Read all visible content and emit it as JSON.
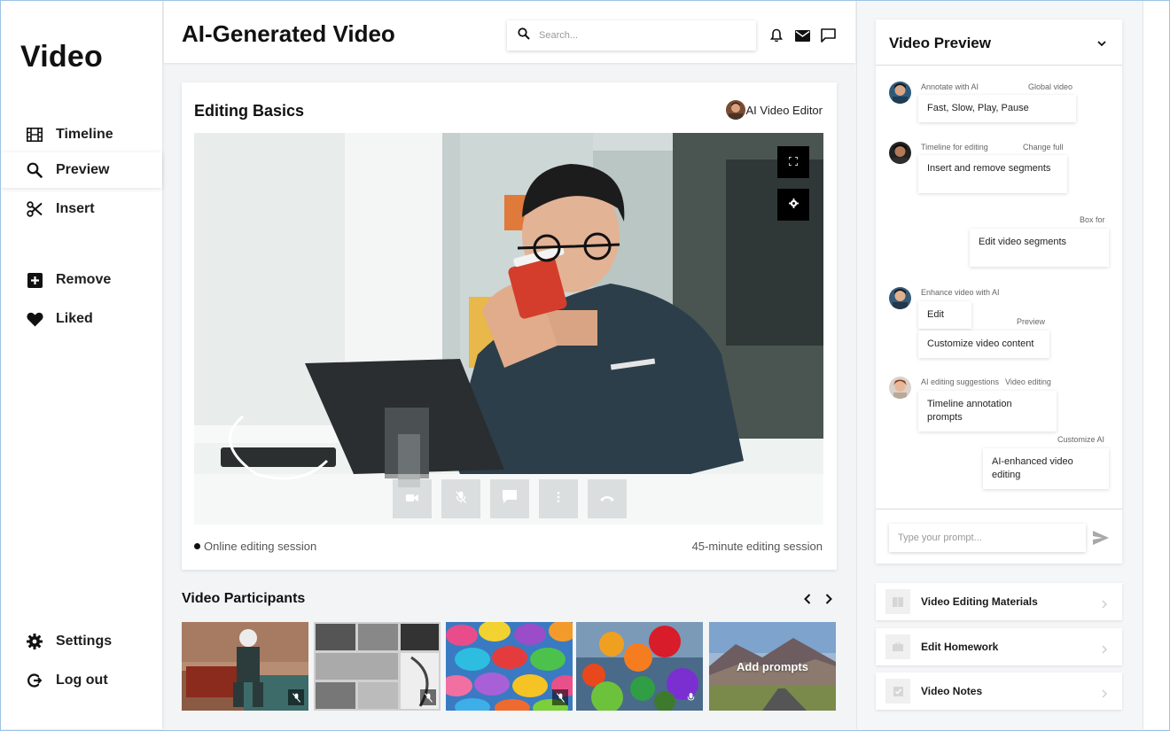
{
  "sidebar": {
    "brand": "Video",
    "items": [
      {
        "label": "Timeline",
        "icon": "film-icon"
      },
      {
        "label": "Preview",
        "icon": "search-icon",
        "active": true
      },
      {
        "label": "Insert",
        "icon": "scissors-icon"
      },
      {
        "label": "Remove",
        "icon": "plus-box-icon"
      },
      {
        "label": "Liked",
        "icon": "heart-icon"
      }
    ],
    "bottom": [
      {
        "label": "Settings",
        "icon": "gear-icon"
      },
      {
        "label": "Log out",
        "icon": "logout-icon"
      }
    ]
  },
  "header": {
    "title": "AI-Generated Video",
    "search_placeholder": "Search..."
  },
  "main": {
    "title": "Editing Basics",
    "editor_label": "AI Video Editor",
    "status_left": "Online editing session",
    "status_right": "45-minute editing session"
  },
  "participants": {
    "title": "Video Participants",
    "add_label": "Add prompts"
  },
  "preview": {
    "title": "Video Preview",
    "messages": [
      {
        "meta_left": "Annotate with AI",
        "meta_right": "Global video",
        "bubble": "Fast, Slow, Play, Pause"
      },
      {
        "meta_left": "Timeline for editing",
        "meta_right": "Change full",
        "bubble": "Insert and remove segments"
      },
      {
        "meta_right": "Box for",
        "bubble": "Edit video segments"
      },
      {
        "meta_left": "Enhance video with AI",
        "bubble": "Edit",
        "meta_mid": "Preview",
        "bubble2": "Customize video content"
      },
      {
        "meta_left": "AI editing suggestions",
        "meta_right": "Video editing",
        "bubble": "Timeline annotation prompts"
      },
      {
        "meta_right": "Customize AI",
        "bubble": "AI-enhanced video editing"
      }
    ],
    "prompt_placeholder": "Type your prompt..."
  },
  "links": [
    {
      "label": "Video Editing Materials"
    },
    {
      "label": "Edit Homework"
    },
    {
      "label": "Video Notes"
    }
  ],
  "colors": {
    "accent": "#111111",
    "panel": "#ffffff",
    "background": "#f2f4f6"
  }
}
